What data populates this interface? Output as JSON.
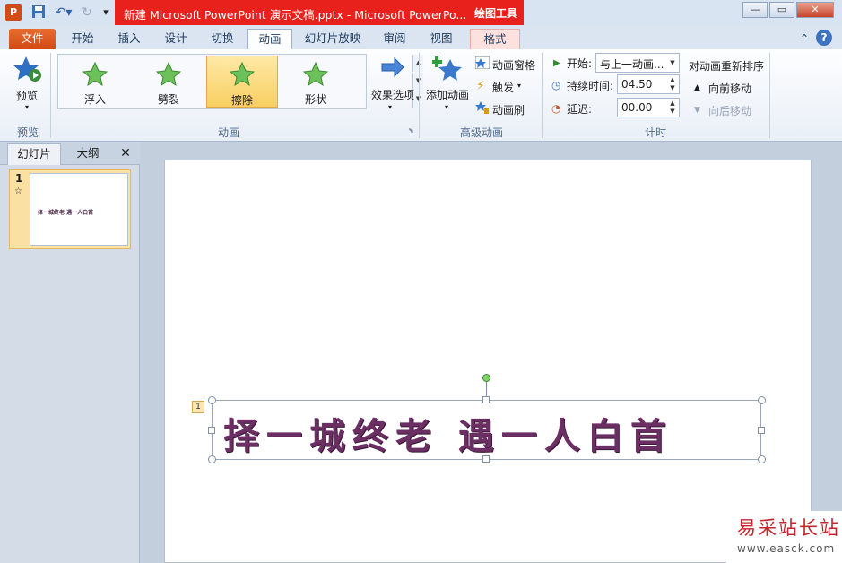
{
  "title_bar": {
    "title": "新建 Microsoft PowerPoint 演示文稿.pptx  -  Microsoft PowerPo...",
    "contextual_tools": "绘图工具",
    "app_icon": "P"
  },
  "tabs": [
    {
      "label": "文件"
    },
    {
      "label": "开始"
    },
    {
      "label": "插入"
    },
    {
      "label": "设计"
    },
    {
      "label": "切换"
    },
    {
      "label": "动画"
    },
    {
      "label": "幻灯片放映"
    },
    {
      "label": "审阅"
    },
    {
      "label": "视图"
    },
    {
      "label": "格式"
    }
  ],
  "ribbon": {
    "preview": {
      "button": "预览",
      "group": "预览"
    },
    "animation_gallery": {
      "items": [
        {
          "label": "浮入"
        },
        {
          "label": "劈裂"
        },
        {
          "label": "擦除"
        },
        {
          "label": "形状"
        }
      ],
      "selected": "擦除",
      "effect_options": "效果选项",
      "group": "动画"
    },
    "advanced": {
      "add_animation": "添加动画",
      "animation_pane": "动画窗格",
      "trigger": "触发",
      "animation_painter": "动画刷",
      "group": "高级动画"
    },
    "timing": {
      "start_label": "开始:",
      "start_value": "与上一动画...",
      "duration_label": "持续时间:",
      "duration_value": "04.50",
      "delay_label": "延迟:",
      "delay_value": "00.00",
      "reorder_title": "对动画重新排序",
      "move_earlier": "向前移动",
      "move_later": "向后移动",
      "group": "计时"
    }
  },
  "left_pane": {
    "tab_slides": "幻灯片",
    "tab_outline": "大纲",
    "slide_number": "1",
    "thumbnail_text": "择一城终老    遇一人白首"
  },
  "slide": {
    "text": "择一城终老   遇一人白首",
    "animation_tag": "1"
  },
  "watermark": {
    "title": "易采站长站",
    "url": "www.easck.com"
  },
  "colors": {
    "title_red": "#e8211d",
    "file_tab": "#d24a14",
    "selected_item": "#f8cf62",
    "slide_text": "#6b2f64"
  }
}
